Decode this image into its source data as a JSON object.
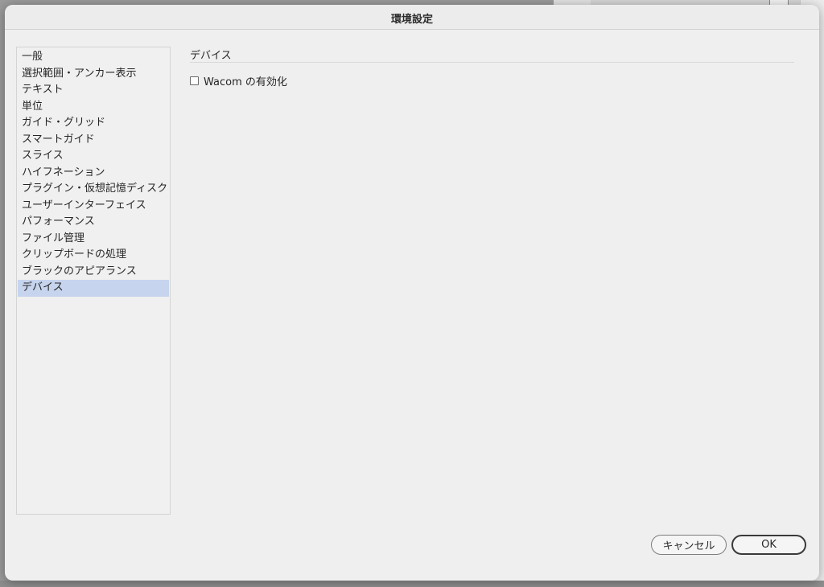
{
  "dialog": {
    "title": "環境設定"
  },
  "sidebar": {
    "items": [
      {
        "label": "一般"
      },
      {
        "label": "選択範囲・アンカー表示"
      },
      {
        "label": "テキスト"
      },
      {
        "label": "単位"
      },
      {
        "label": "ガイド・グリッド"
      },
      {
        "label": "スマートガイド"
      },
      {
        "label": "スライス"
      },
      {
        "label": "ハイフネーション"
      },
      {
        "label": "プラグイン・仮想記憶ディスク"
      },
      {
        "label": "ユーザーインターフェイス"
      },
      {
        "label": "パフォーマンス"
      },
      {
        "label": "ファイル管理"
      },
      {
        "label": "クリップボードの処理"
      },
      {
        "label": "ブラックのアピアランス"
      },
      {
        "label": "デバイス"
      }
    ],
    "selected_index": 14
  },
  "main": {
    "section_title": "デバイス",
    "wacom_label": "Wacom の有効化",
    "wacom_checked": false
  },
  "footer": {
    "cancel_label": "キャンセル",
    "ok_label": "OK"
  },
  "colors": {
    "selection": "#c6d4ee",
    "dialog_bg": "#efefef"
  }
}
